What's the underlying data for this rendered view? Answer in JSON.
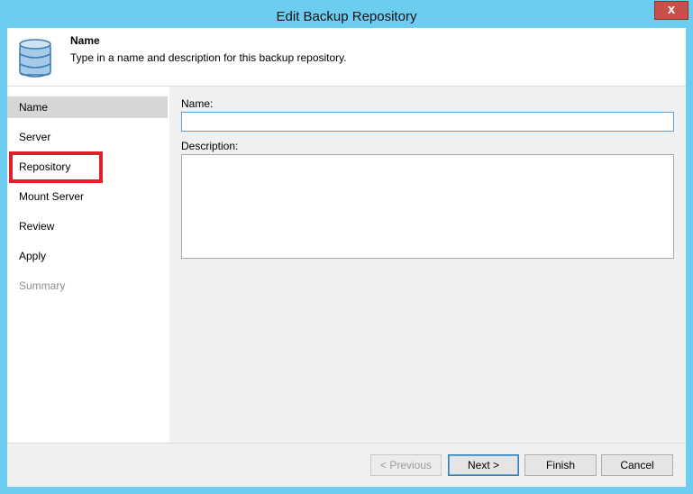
{
  "window": {
    "title": "Edit Backup Repository",
    "close_glyph": "x"
  },
  "header": {
    "title": "Name",
    "subtitle": "Type in a name and description for this backup repository.",
    "icon": "database-icon"
  },
  "sidebar": {
    "items": [
      {
        "label": "Name",
        "state": "active"
      },
      {
        "label": "Server",
        "state": "normal"
      },
      {
        "label": "Repository",
        "state": "normal"
      },
      {
        "label": "Mount Server",
        "state": "normal"
      },
      {
        "label": "Review",
        "state": "normal"
      },
      {
        "label": "Apply",
        "state": "normal"
      },
      {
        "label": "Summary",
        "state": "disabled"
      }
    ]
  },
  "form": {
    "name_label": "Name:",
    "name_value": "",
    "description_label": "Description:",
    "description_value": ""
  },
  "buttons": {
    "previous": "< Previous",
    "next": "Next >",
    "finish": "Finish",
    "cancel": "Cancel"
  },
  "colors": {
    "frame": "#6ccdf0",
    "close": "#c7504a",
    "highlight": "#e01f2d",
    "active_item": "#d6d6d6"
  }
}
